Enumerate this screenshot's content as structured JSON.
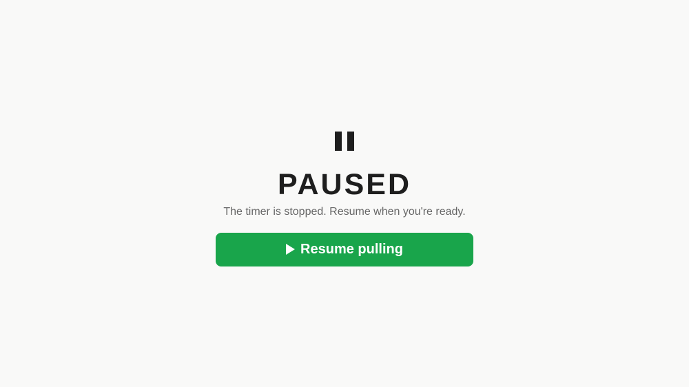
{
  "screen": {
    "icon": "pause-icon",
    "title": "PAUSED",
    "message": "The timer is stopped. Resume when you're ready."
  },
  "resume_button": {
    "icon": "play-icon",
    "label": "Resume pulling"
  },
  "colors": {
    "background": "#f9f9f8",
    "text_primary": "#1e1e1e",
    "text_secondary": "#666666",
    "accent": "#19a54b"
  }
}
